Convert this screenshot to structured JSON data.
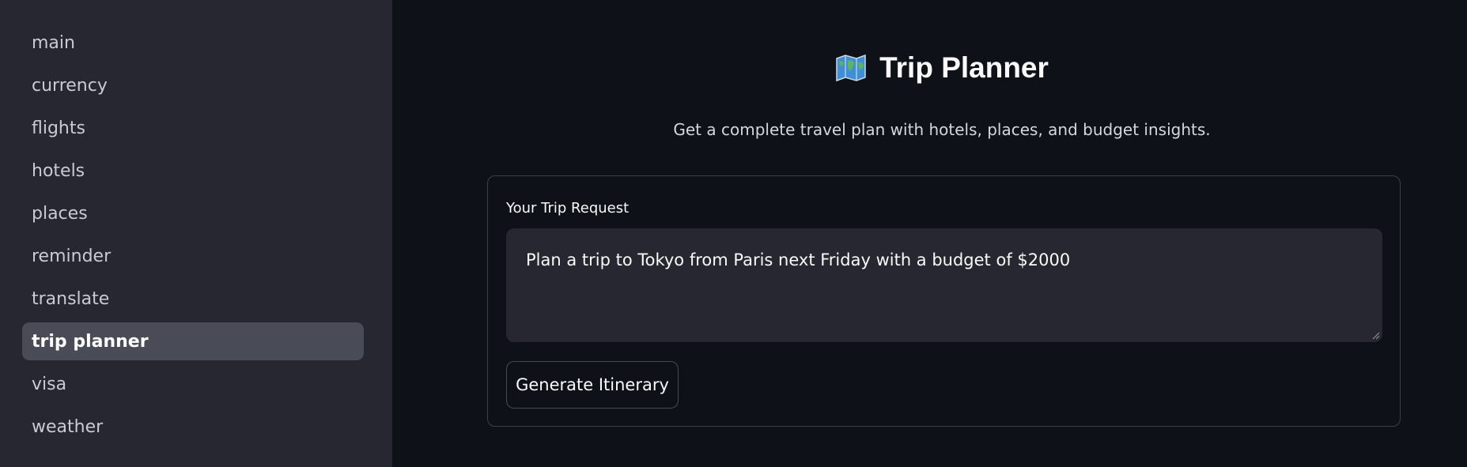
{
  "sidebar": {
    "items": [
      {
        "label": "main"
      },
      {
        "label": "currency"
      },
      {
        "label": "flights"
      },
      {
        "label": "hotels"
      },
      {
        "label": "places"
      },
      {
        "label": "reminder"
      },
      {
        "label": "translate"
      },
      {
        "label": "trip planner",
        "active": true
      },
      {
        "label": "visa"
      },
      {
        "label": "weather"
      }
    ]
  },
  "header": {
    "icon": "world-map-icon",
    "title": "Trip Planner",
    "subtitle": "Get a complete travel plan with hotels, places, and budget insights."
  },
  "form": {
    "field_label": "Your Trip Request",
    "textarea_value": "Plan a trip to Tokyo from Paris next Friday with a budget of $2000",
    "button_label": "Generate Itinerary"
  },
  "colors": {
    "background": "#0e1117",
    "sidebar": "#262730",
    "active_item": "#494b57",
    "input_background": "#262730",
    "text": "#fafafa"
  }
}
